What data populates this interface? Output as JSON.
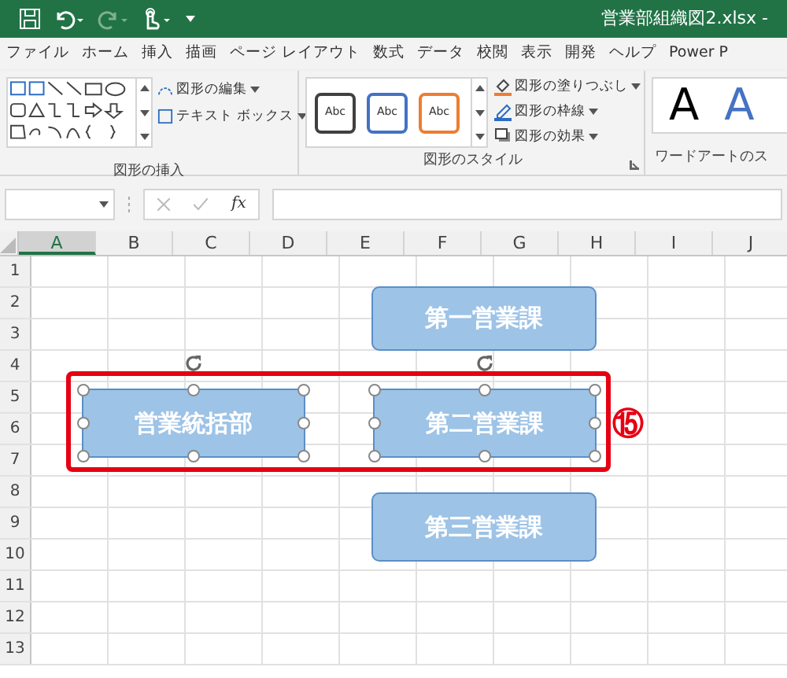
{
  "window": {
    "title": "営業部組織図2.xlsx -"
  },
  "quick_access": [
    {
      "kind": "save",
      "disabled": false
    },
    {
      "kind": "undo",
      "disabled": false
    },
    {
      "kind": "redo",
      "disabled": true
    },
    {
      "kind": "touch",
      "disabled": false
    }
  ],
  "tabs": [
    {
      "label": "ファイル",
      "selected": false
    },
    {
      "label": "ホーム",
      "selected": false
    },
    {
      "label": "挿入",
      "selected": false
    },
    {
      "label": "描画",
      "selected": false
    },
    {
      "label": "ページ レイアウト",
      "selected": false
    },
    {
      "label": "数式",
      "selected": false
    },
    {
      "label": "データ",
      "selected": false
    },
    {
      "label": "校閲",
      "selected": false
    },
    {
      "label": "表示",
      "selected": false
    },
    {
      "label": "開発",
      "selected": false
    },
    {
      "label": "ヘルプ",
      "selected": false
    },
    {
      "label": "Power P",
      "selected": false
    }
  ],
  "ribbon": {
    "insert_group": {
      "label": "図形の挿入",
      "buttons": [
        "図形の編集",
        "テキスト ボックス"
      ]
    },
    "style_group": {
      "label": "図形のスタイル",
      "presets": [
        {
          "text": "Abc",
          "color": "#404040"
        },
        {
          "text": "Abc",
          "color": "#4472c4"
        },
        {
          "text": "Abc",
          "color": "#ed7d31"
        }
      ],
      "buttons": [
        {
          "kind": "fill",
          "label": "図形の塗りつぶし"
        },
        {
          "kind": "outline",
          "label": "図形の枠線"
        },
        {
          "kind": "effect",
          "label": "図形の効果"
        }
      ]
    },
    "wordart_group": {
      "label": "ワードアートのス",
      "samples": [
        {
          "text": "A",
          "color": "#000000"
        },
        {
          "text": "A",
          "color": "#4472c4"
        }
      ]
    }
  },
  "formula_bar": {
    "fx": "fx"
  },
  "columns": [
    "A",
    "B",
    "C",
    "D",
    "E",
    "F",
    "G",
    "H",
    "I",
    "J"
  ],
  "rows": [
    "1",
    "2",
    "3",
    "4",
    "5",
    "6",
    "7",
    "8",
    "9",
    "10",
    "11",
    "12",
    "13"
  ],
  "shapes": [
    {
      "text": "第一営業課",
      "selected": false
    },
    {
      "text": "営業統括部",
      "selected": true
    },
    {
      "text": "第二営業課",
      "selected": true
    },
    {
      "text": "第三営業課",
      "selected": false
    }
  ],
  "annotation": {
    "text": "⑮"
  }
}
